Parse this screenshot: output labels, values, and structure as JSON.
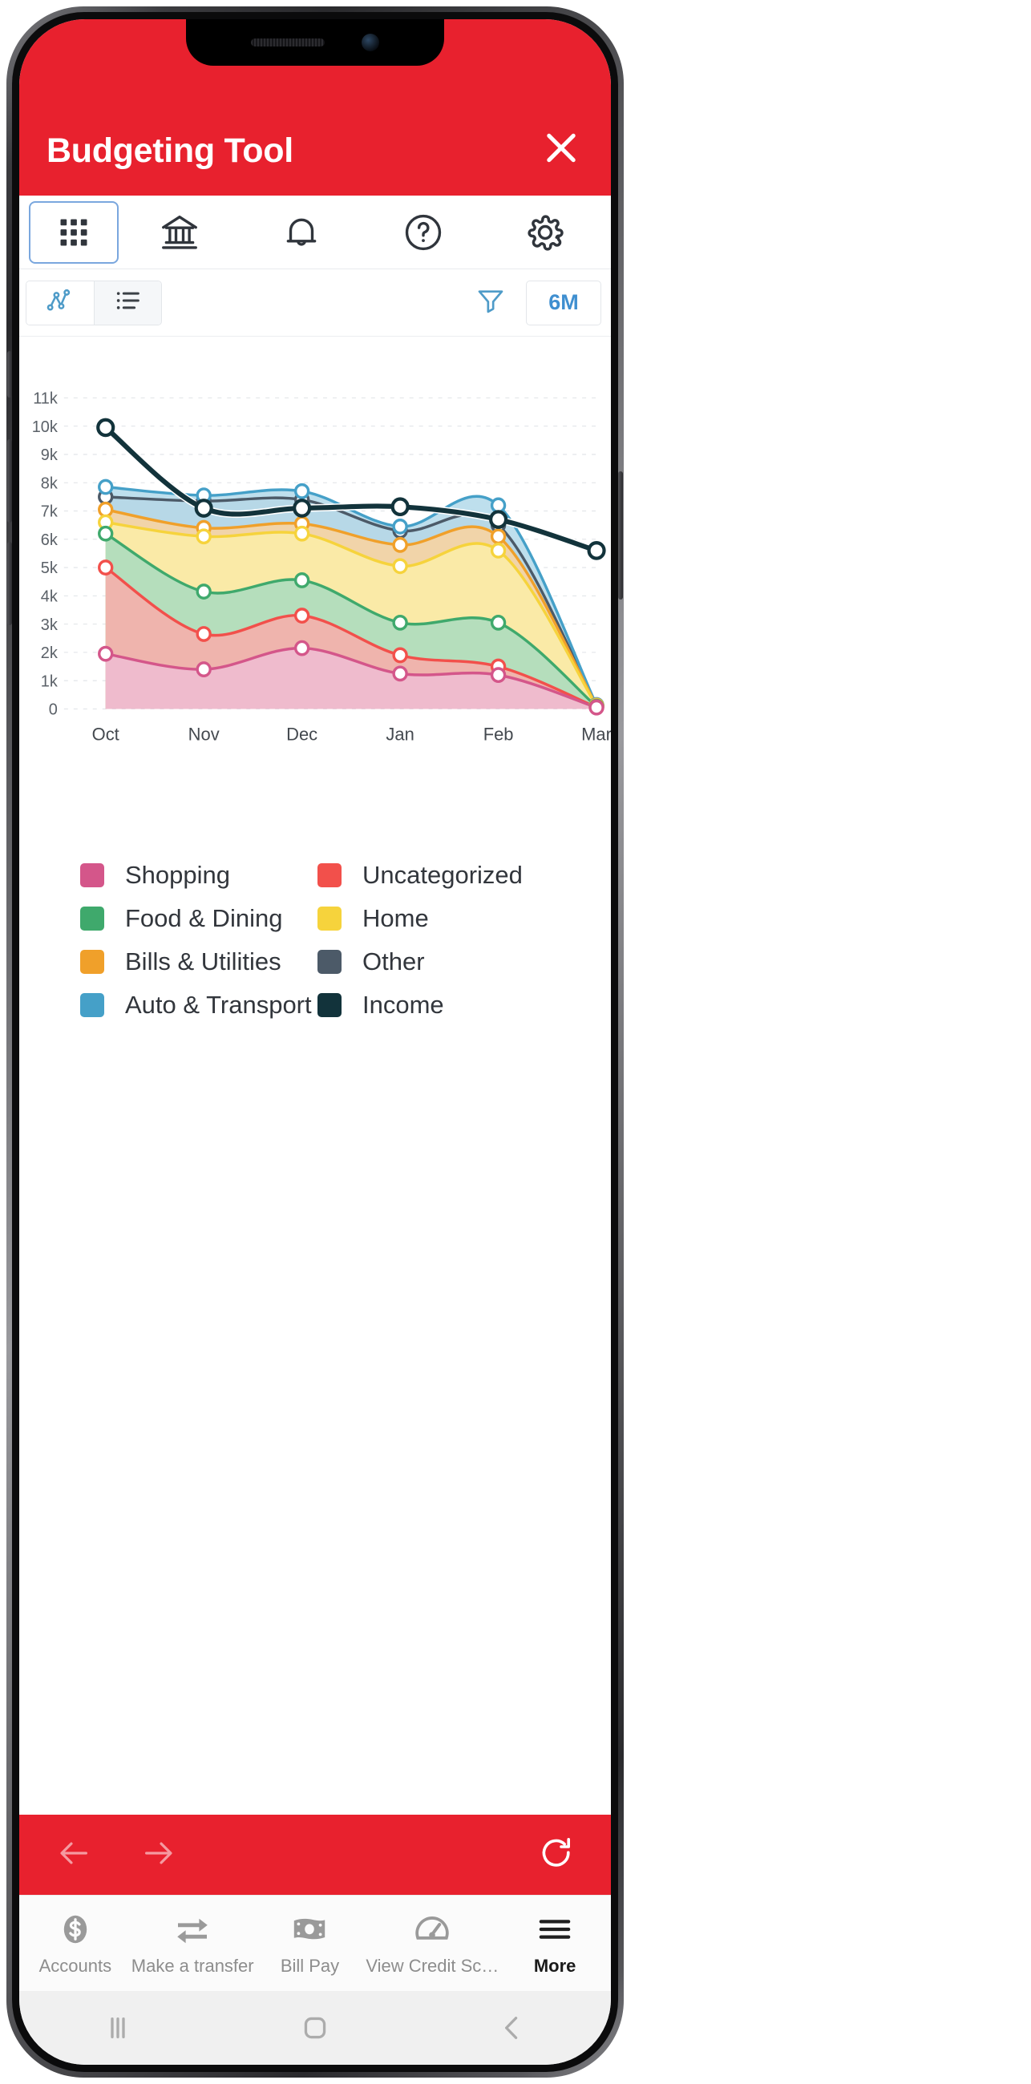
{
  "header": {
    "title": "Budgeting Tool",
    "close_label": "✕",
    "bg_color": "#e8212e"
  },
  "icon_tabs": [
    {
      "name": "apps-grid",
      "icon": "grid-icon",
      "active": true
    },
    {
      "name": "accounts-bank",
      "icon": "bank-icon",
      "active": false
    },
    {
      "name": "notifications",
      "icon": "bell-icon",
      "active": false
    },
    {
      "name": "help",
      "icon": "question-circle-icon",
      "active": false
    },
    {
      "name": "settings",
      "icon": "gear-icon",
      "active": false
    }
  ],
  "sub_toolbar": {
    "chart_view_icon": "line-chart-icon",
    "list_view_icon": "list-icon",
    "chart_view_active": true,
    "filter_icon": "filter-icon",
    "range_label": "6M",
    "accent_color": "#3f8fd0"
  },
  "chart_data": {
    "type": "area",
    "title": "",
    "xlabel": "",
    "ylabel": "",
    "categories": [
      "Oct",
      "Nov",
      "Dec",
      "Jan",
      "Feb",
      "Mar"
    ],
    "ytick_labels": [
      "0",
      "1k",
      "2k",
      "3k",
      "4k",
      "5k",
      "6k",
      "7k",
      "8k",
      "9k",
      "10k",
      "11k"
    ],
    "ylim": [
      0,
      11000
    ],
    "grid": true,
    "legend_position": "below",
    "series": [
      {
        "name": "Shopping",
        "color": "#d4568a",
        "fill": "#efbcd1",
        "values": [
          1950,
          1400,
          2150,
          1250,
          1200,
          50
        ]
      },
      {
        "name": "Uncategorized",
        "color": "#f2504b",
        "fill": "#f7aeab",
        "values": [
          5000,
          2650,
          3300,
          1900,
          1500,
          60
        ]
      },
      {
        "name": "Food & Dining",
        "color": "#3fa96c",
        "fill": "#abdcbf",
        "values": [
          6200,
          4150,
          4550,
          3050,
          3050,
          80
        ]
      },
      {
        "name": "Home",
        "color": "#f6d33c",
        "fill": "#fbeda6",
        "values": [
          6600,
          6100,
          6200,
          5050,
          5600,
          100
        ]
      },
      {
        "name": "Bills & Utilities",
        "color": "#f0a02a",
        "fill": "#f9d3a0",
        "values": [
          7050,
          6400,
          6550,
          5800,
          6100,
          120
        ]
      },
      {
        "name": "Auto & Transport",
        "color": "#45a0c8",
        "fill": "#b5dbeb",
        "values": [
          7850,
          7550,
          7700,
          6450,
          7200,
          140
        ]
      },
      {
        "name": "Other",
        "color": "#4c5a68",
        "fill": "#b7bec6",
        "values": [
          7500,
          7350,
          7400,
          6300,
          6500,
          130
        ]
      },
      {
        "name": "Income",
        "color": "#12333b",
        "fill": "none",
        "values": [
          9950,
          7100,
          7100,
          7150,
          6700,
          5600
        ]
      }
    ]
  },
  "legend": [
    {
      "label": "Shopping",
      "color": "#d4568a"
    },
    {
      "label": "Uncategorized",
      "color": "#f2504b"
    },
    {
      "label": "Food & Dining",
      "color": "#3fa96c"
    },
    {
      "label": "Home",
      "color": "#f6d33c"
    },
    {
      "label": "Bills & Utilities",
      "color": "#f0a02a"
    },
    {
      "label": "Other",
      "color": "#4c5a68"
    },
    {
      "label": "Auto & Transport",
      "color": "#45a0c8"
    },
    {
      "label": "Income",
      "color": "#12333b"
    }
  ],
  "action_bar": {
    "back_icon": "arrow-left-icon",
    "forward_icon": "arrow-right-icon",
    "refresh_icon": "refresh-icon",
    "bg_color": "#e8212e"
  },
  "bottom_tabs": [
    {
      "label": "Accounts",
      "icon": "dollar-coin-icon",
      "active": false
    },
    {
      "label": "Make a transfer",
      "icon": "transfer-icon",
      "active": false
    },
    {
      "label": "Bill Pay",
      "icon": "banknote-icon",
      "active": false
    },
    {
      "label": "View Credit Sc…",
      "icon": "speedometer-icon",
      "active": false
    },
    {
      "label": "More",
      "icon": "hamburger-icon",
      "active": true
    }
  ],
  "android_nav": [
    {
      "name": "recents",
      "icon": "recents-icon"
    },
    {
      "name": "home",
      "icon": "home-square-icon"
    },
    {
      "name": "back",
      "icon": "back-chevron-icon"
    }
  ]
}
